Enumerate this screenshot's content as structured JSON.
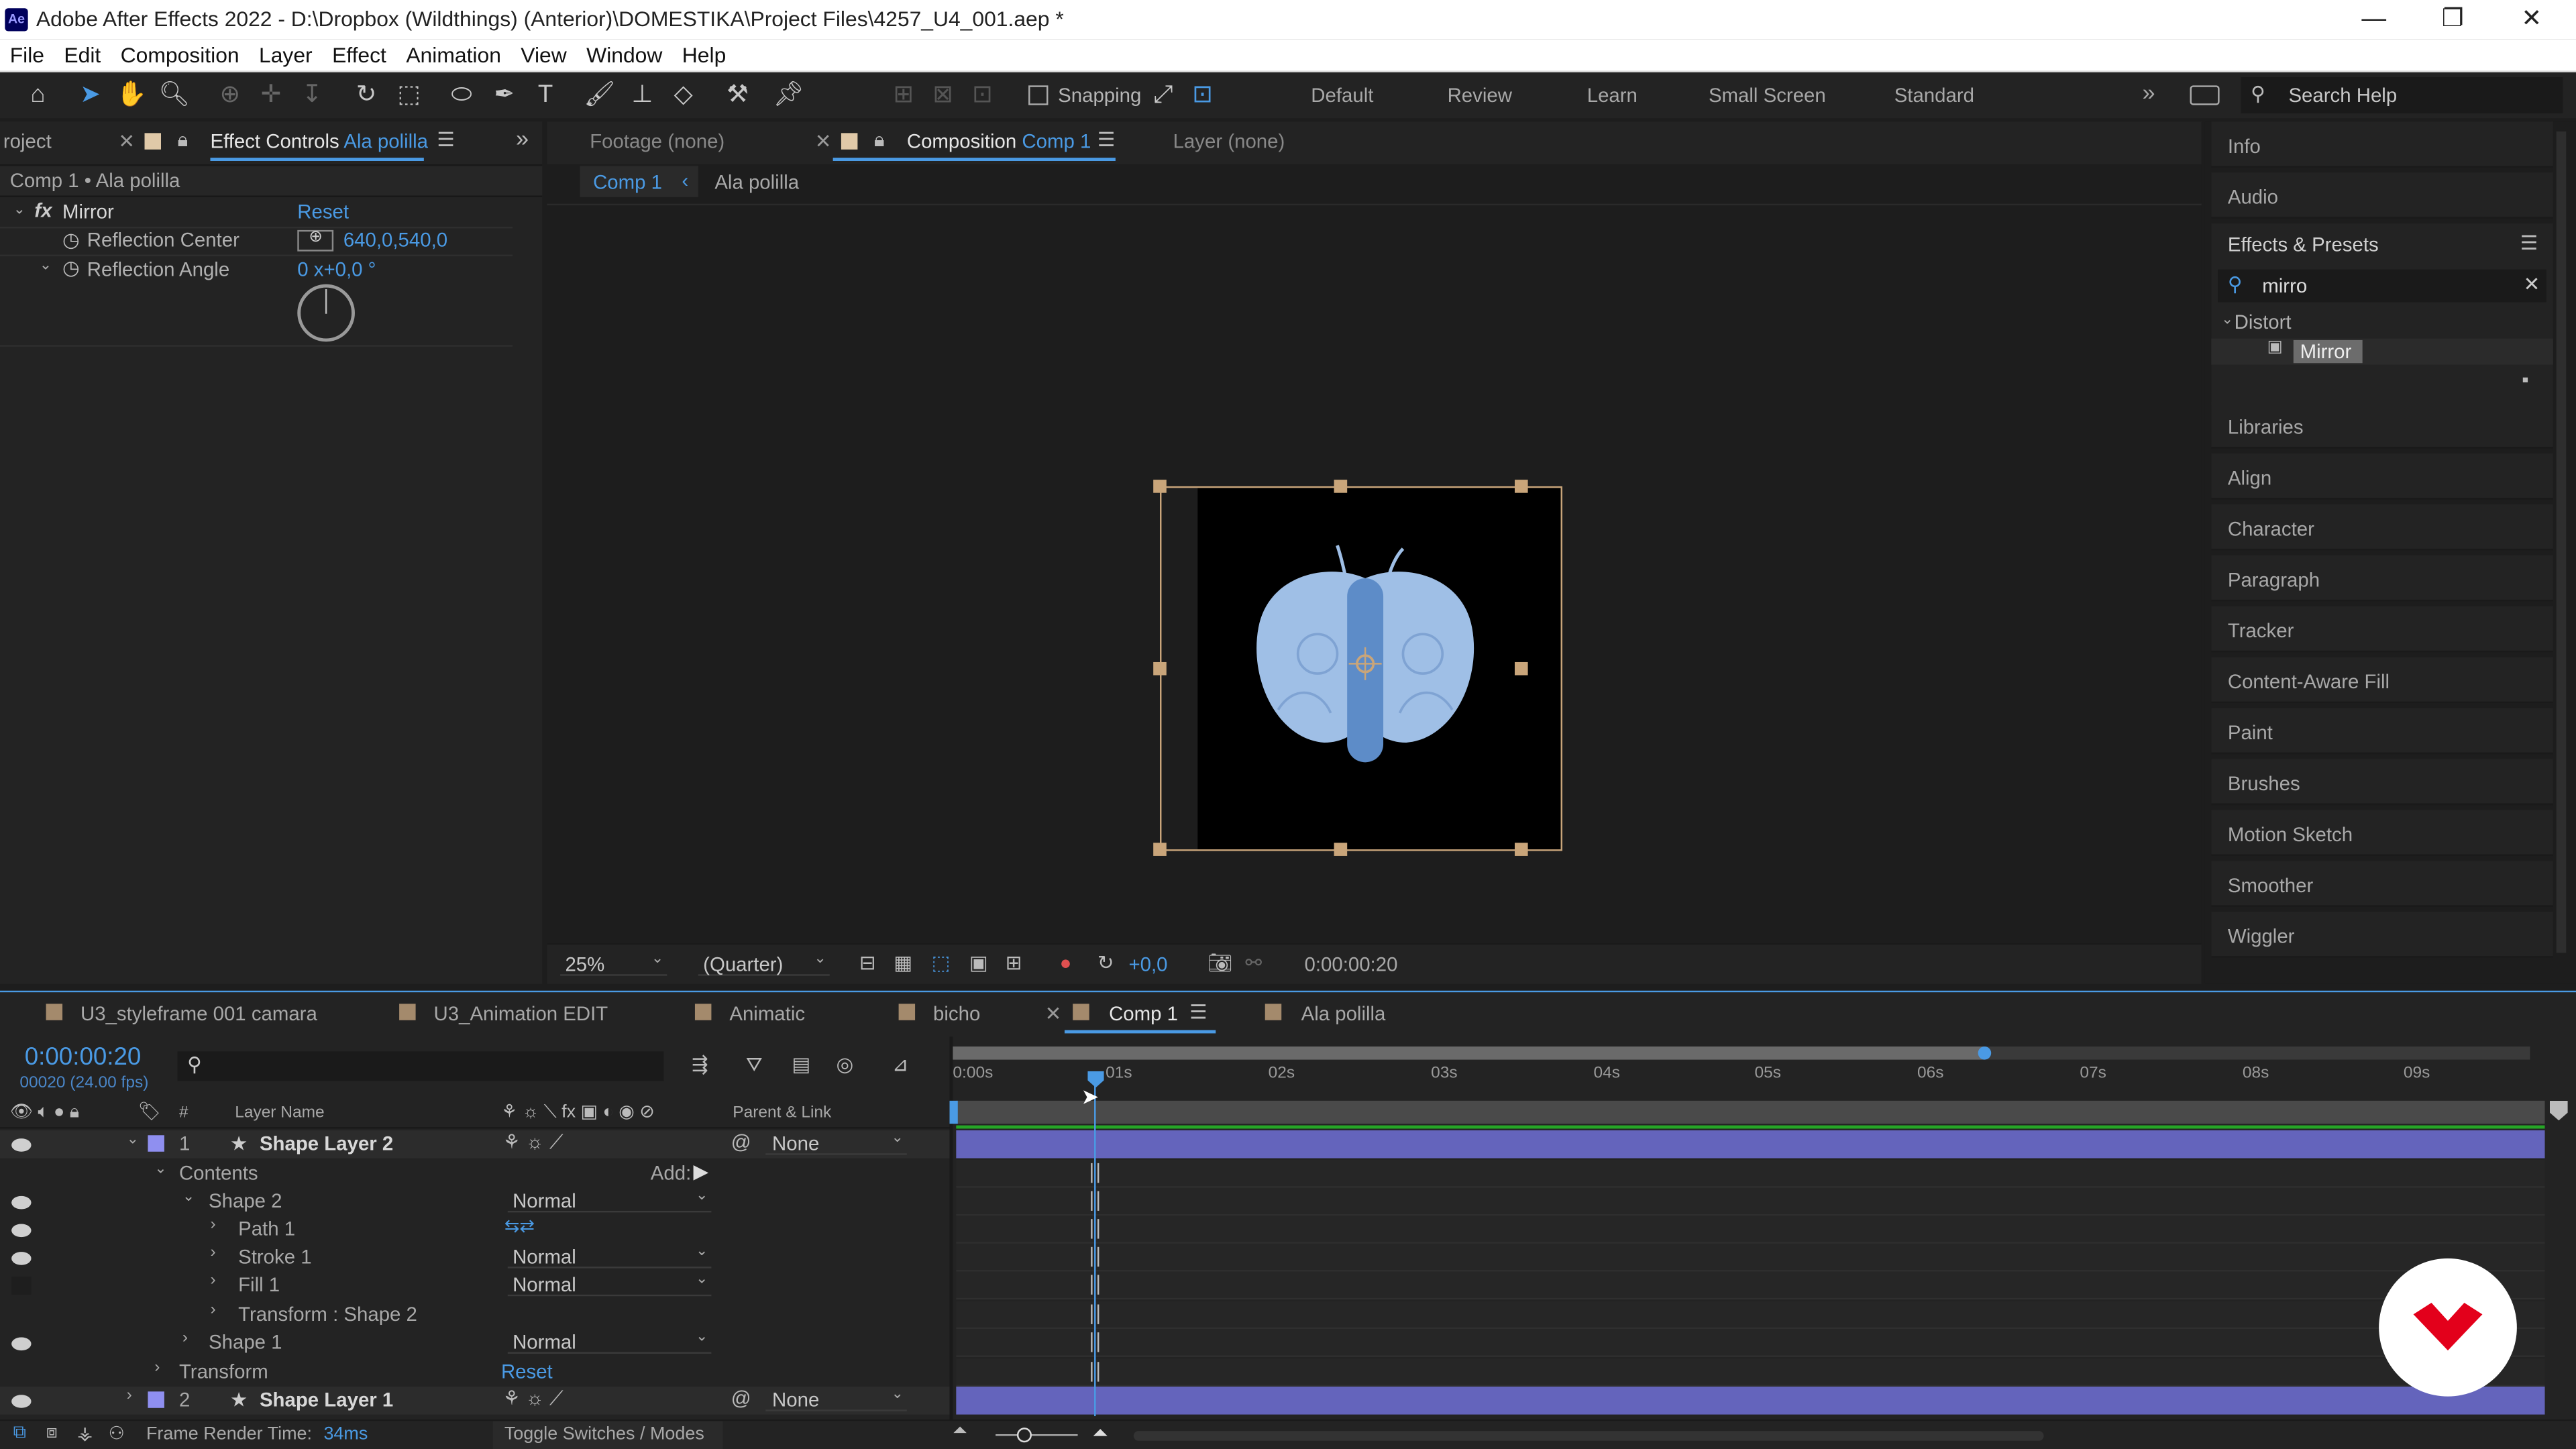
{
  "titlebar": {
    "title": "Adobe After Effects 2022 - D:\\Dropbox (Wildthings) (Anterior)\\DOMESTIKA\\Project Files\\4257_U4_001.aep *",
    "minimize": "—",
    "restore": "❐",
    "close": "✕",
    "app_icon": "Ae"
  },
  "menu": [
    "File",
    "Edit",
    "Composition",
    "Layer",
    "Effect",
    "Animation",
    "View",
    "Window",
    "Help"
  ],
  "toolbar": {
    "snapping": "Snapping",
    "workspaces": [
      "Default",
      "Review",
      "Learn",
      "Small Screen",
      "Standard"
    ],
    "more": "»",
    "search_help": "Search Help"
  },
  "left_panel": {
    "project_tab": "roject",
    "effect_controls_tab": "Effect Controls",
    "effect_controls_layer": "Ala polilla",
    "header": "Comp 1 • Ala polilla",
    "effect": {
      "name": "Mirror",
      "reset": "Reset"
    },
    "props": [
      {
        "label": "Reflection Center",
        "value": "640,0,540,0"
      },
      {
        "label": "Reflection Angle",
        "value": "0 x+0,0 °"
      }
    ]
  },
  "viewer": {
    "footage_tab": "Footage",
    "footage_value": "(none)",
    "comp_tab": "Composition",
    "comp_name": "Comp 1",
    "layer_tab": "Layer",
    "layer_value": "(none)",
    "breadcrumb": [
      "Comp 1",
      "Ala polilla"
    ],
    "zoom": "25%",
    "resolution": "(Quarter)",
    "exposure": "+0,0",
    "timecode": "0:00:00:20"
  },
  "right_panel": {
    "info": "Info",
    "audio": "Audio",
    "effects_presets": "Effects & Presets",
    "search_value": "mirro",
    "category": "Distort",
    "result": "Mirror",
    "items": [
      "Libraries",
      "Align",
      "Character",
      "Paragraph",
      "Tracker",
      "Content-Aware Fill",
      "Paint",
      "Brushes",
      "Motion Sketch",
      "Smoother",
      "Wiggler"
    ]
  },
  "timeline": {
    "tabs": [
      "U3_styleframe 001 camara",
      "U3_Animation EDIT",
      "Animatic",
      "bicho",
      "Comp 1",
      "Ala polilla"
    ],
    "tab_colors": [
      "#a48a6c",
      "#a48a6c",
      "#a48a6c",
      "#a48a6c",
      "#a48a6c",
      "#a48a6c"
    ],
    "active_tab": "Comp 1",
    "timecode": "0:00:00:20",
    "fps": "00020 (24.00 fps)",
    "col_layer_name": "Layer Name",
    "col_hash": "#",
    "col_parent": "Parent & Link",
    "ruler": [
      "0:00s",
      "01s",
      "02s",
      "03s",
      "04s",
      "05s",
      "06s",
      "07s",
      "08s",
      "09s"
    ],
    "layers": [
      {
        "num": "1",
        "name": "Shape Layer 2",
        "parent": "None"
      },
      {
        "num": "2",
        "name": "Shape Layer 1",
        "parent": "None"
      }
    ],
    "contents": "Contents",
    "add": "Add:",
    "shape2": "Shape 2",
    "path1": "Path 1",
    "stroke1": "Stroke 1",
    "fill1": "Fill 1",
    "transform_shape2": "Transform : Shape 2",
    "shape1": "Shape 1",
    "transform": "Transform",
    "reset": "Reset",
    "mode": "Normal",
    "frame_render_label": "Frame Render Time:",
    "frame_render_value": "34ms",
    "toggle": "Toggle Switches / Modes"
  },
  "colors": {
    "accent_blue": "#4a9ae4",
    "label_purple": "#8f8ff0",
    "track_purple": "#6464bc",
    "moth_light": "#9fbfe6",
    "moth_dark": "#5d8cc8",
    "logo_red": "#e3001b"
  }
}
